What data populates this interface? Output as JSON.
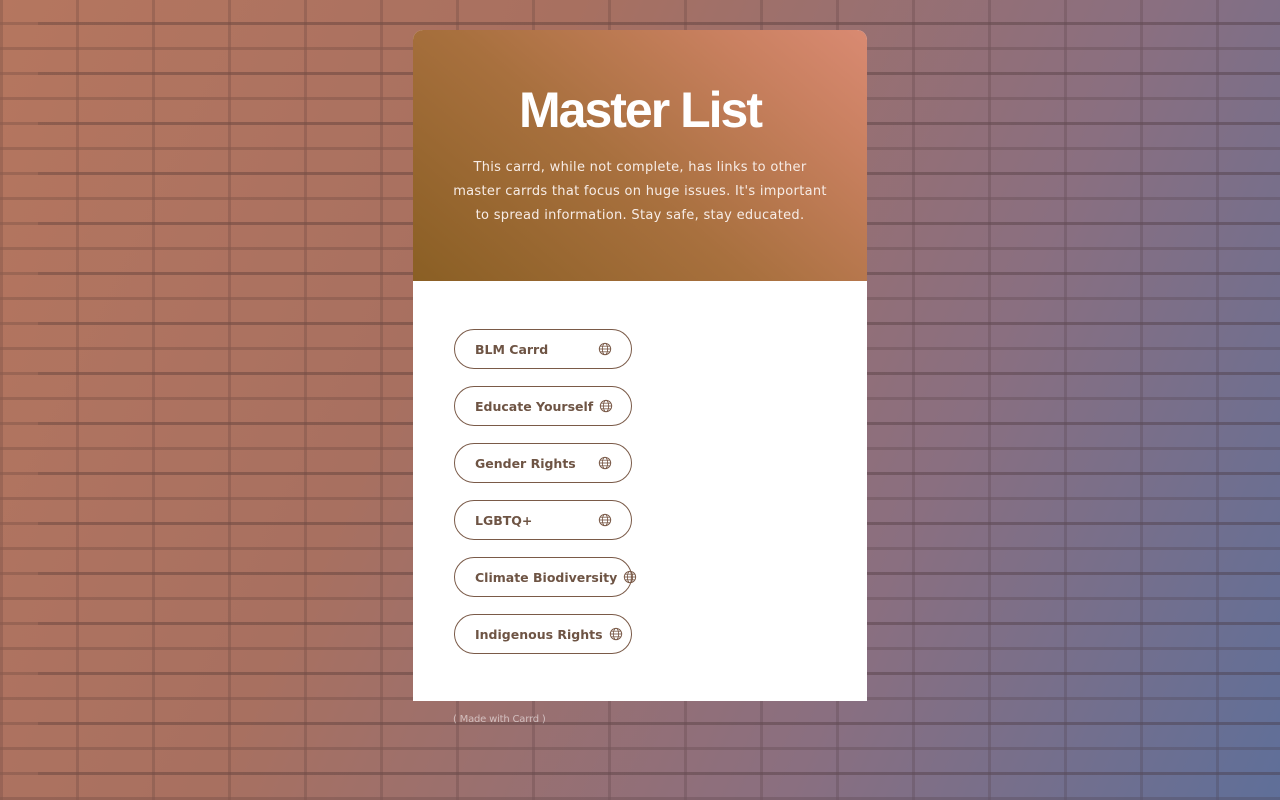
{
  "page": {
    "title": "Master List",
    "description": "This carrd, while not complete, has links to other master carrds that focus on huge issues. It's important to spread information. Stay safe, stay educated."
  },
  "links": [
    {
      "label": "BLM Carrd",
      "icon": "globe-icon"
    },
    {
      "label": "Educate Yourself",
      "icon": "globe-icon"
    },
    {
      "label": "Gender Rights",
      "icon": "globe-icon"
    },
    {
      "label": "LGBTQ+",
      "icon": "globe-icon"
    },
    {
      "label": "Climate Biodiversity",
      "icon": "globe-icon"
    },
    {
      "label": "Indigenous Rights",
      "icon": "globe-icon"
    }
  ],
  "footer": {
    "credit": "( Made with Carrd )"
  },
  "colors": {
    "header_gradient_start": "#8a5f24",
    "header_gradient_end": "#d98a72",
    "button_border": "#7a5a48",
    "button_text": "#6e5444"
  }
}
